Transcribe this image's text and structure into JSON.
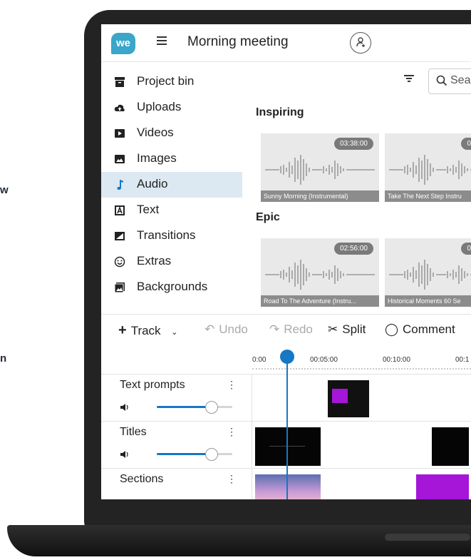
{
  "edge_text": [
    "w",
    "n"
  ],
  "project": {
    "title": "Morning meeting",
    "logo_text": "we"
  },
  "sidebar": {
    "items": [
      {
        "label": "Project bin",
        "icon": "archive-icon"
      },
      {
        "label": "Uploads",
        "icon": "cloud-upload-icon"
      },
      {
        "label": "Videos",
        "icon": "video-icon"
      },
      {
        "label": "Images",
        "icon": "image-icon"
      },
      {
        "label": "Audio",
        "icon": "music-note-icon",
        "active": true
      },
      {
        "label": "Text",
        "icon": "text-icon"
      },
      {
        "label": "Transitions",
        "icon": "transition-icon"
      },
      {
        "label": "Extras",
        "icon": "smiley-icon"
      },
      {
        "label": "Backgrounds",
        "icon": "backgrounds-icon"
      }
    ]
  },
  "search": {
    "placeholder": "Sea"
  },
  "library": {
    "sections": [
      {
        "title": "Inspiring",
        "cards": [
          {
            "duration": "03:38:00",
            "name": "Sunny Morning (Instrumental)"
          },
          {
            "duration": "0",
            "name": "Take The Next Step Instru"
          }
        ]
      },
      {
        "title": "Epic",
        "cards": [
          {
            "duration": "02:56:00",
            "name": "Road To The Adventure (Instru..."
          },
          {
            "duration": "0",
            "name": "Historical Moments 60 Se"
          }
        ]
      }
    ]
  },
  "toolbar": {
    "track": "Track",
    "undo": "Undo",
    "redo": "Redo",
    "split": "Split",
    "comment": "Comment"
  },
  "ruler": {
    "ticks": [
      "0:00",
      "00:05:00",
      "00:10:00",
      "00:1"
    ]
  },
  "tracks": [
    {
      "name": "Text prompts",
      "volume": 0.72
    },
    {
      "name": "Titles",
      "volume": 0.72
    },
    {
      "name": "Sections"
    }
  ],
  "colors": {
    "accent": "#1677c5",
    "logo": "#3aa6c9",
    "active_bg": "#dce9f2",
    "clip_purple": "#a516d8"
  }
}
